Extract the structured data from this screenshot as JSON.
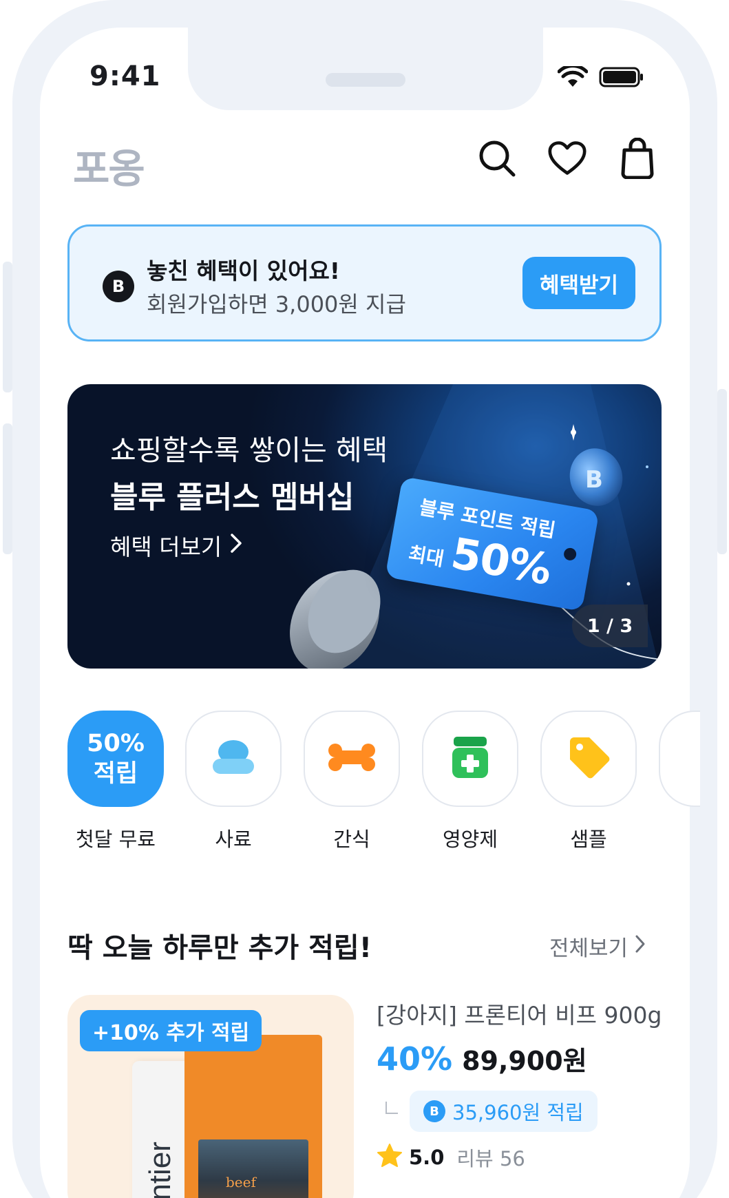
{
  "status_bar": {
    "time": "9:41",
    "wifi_icon": "wifi-icon",
    "battery_icon": "battery-icon"
  },
  "header": {
    "logo": "포옹",
    "icons": [
      "search-icon",
      "heart-icon",
      "shopping-bag-icon"
    ]
  },
  "benefit_banner": {
    "badge": "B",
    "title": "놓친 혜택이 있어요!",
    "subtitle": "회원가입하면 3,000원 지급",
    "button_label": "혜택받기"
  },
  "promo_banner": {
    "line1": "쇼핑할수록 쌓이는 혜택",
    "line2": "블루 플러스 멤버십",
    "link_label": "혜택 더보기",
    "tag_line1": "블루 포인트 적립",
    "tag_prefix": "최대",
    "tag_percent": "50%",
    "pager": "1 / 3"
  },
  "categories": [
    {
      "id": "first-month",
      "tile_line1": "50%",
      "tile_line2": "적립",
      "label": "첫달 무료",
      "icon": ""
    },
    {
      "id": "food",
      "label": "사료",
      "icon": "food-bowl-icon"
    },
    {
      "id": "snack",
      "label": "간식",
      "icon": "bone-icon"
    },
    {
      "id": "supplement",
      "label": "영양제",
      "icon": "supplement-jar-icon"
    },
    {
      "id": "sample",
      "label": "샘플",
      "icon": "price-tag-icon"
    }
  ],
  "section": {
    "title": "딱 오늘 하루만 추가 적립!",
    "more_label": "전체보기"
  },
  "product": {
    "badge": "+10% 추가 적립",
    "name": "[강아지] 프론티어 비프 900g",
    "discount": "40%",
    "price": "89,900원",
    "reward_badge": "B",
    "reward": "35,960원 적립",
    "rating": "5.0",
    "review_label": "리뷰 56",
    "brand": "frontier",
    "package_text": "beef"
  },
  "colors": {
    "accent": "#2b9cf6",
    "logo_gray": "#aeb5c2",
    "banner_bg": "#ebf5fe",
    "promo_bg": "#0a1a38",
    "product_bg": "#fcefe1",
    "star": "#ffc21a"
  }
}
